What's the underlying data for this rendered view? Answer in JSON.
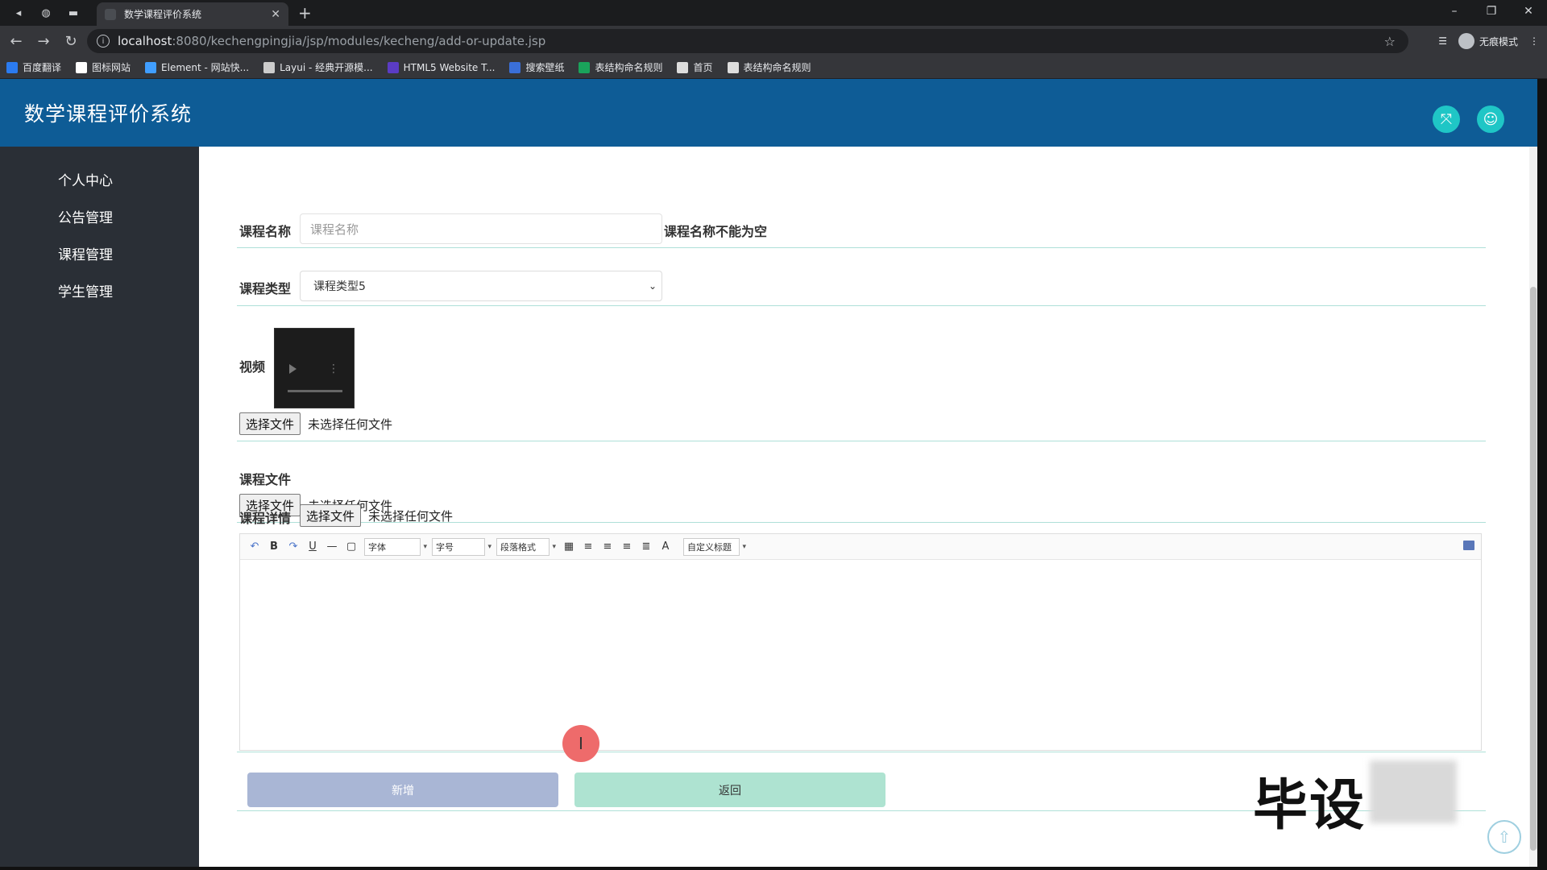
{
  "browser": {
    "tab_title": "数学课程评价系统",
    "tab_close": "✕",
    "new_tab": "+",
    "url_host": "localhost",
    "url_path": ":8080/kechengpingjia/jsp/modules/kecheng/add-or-update.jsp",
    "incognito_label": "无痕模式",
    "bookmarks": [
      {
        "label": "百度翻译",
        "color": "#2b7bf0"
      },
      {
        "label": "图标网站",
        "color": "#ffffff"
      },
      {
        "label": "Element - 网站快...",
        "color": "#409eff"
      },
      {
        "label": "Layui - 经典开源模...",
        "color": "#cccccc"
      },
      {
        "label": "HTML5 Website T...",
        "color": "#5b3cc4"
      },
      {
        "label": "搜索壁纸",
        "color": "#3a6fd8"
      },
      {
        "label": "表结构命名规则",
        "color": "#1aa35b"
      },
      {
        "label": "首页",
        "color": "#dddddd"
      },
      {
        "label": "表结构命名规则",
        "color": "#dddddd"
      }
    ]
  },
  "app": {
    "title": "数学课程评价系统",
    "colors": {
      "header": "#0e5c96",
      "sidebar": "#2a2f36",
      "accent": "#1fc6c6"
    }
  },
  "sidebar": {
    "items": [
      {
        "label": "个人中心"
      },
      {
        "label": "公告管理"
      },
      {
        "label": "课程管理"
      },
      {
        "label": "学生管理"
      }
    ]
  },
  "form": {
    "course_name": {
      "label": "课程名称",
      "placeholder": "课程名称",
      "value": "",
      "error": "课程名称不能为空"
    },
    "course_type": {
      "label": "课程类型",
      "selected": "课程类型5"
    },
    "video": {
      "label": "视频",
      "file_button": "选择文件",
      "file_status": "未选择任何文件"
    },
    "course_file": {
      "label": "课程文件",
      "file_button": "选择文件",
      "file_status": "未选择任何文件"
    },
    "course_detail": {
      "label": "课程详情",
      "file_button": "选择文件",
      "file_status": "未选择任何文件"
    }
  },
  "editor": {
    "font_family": "字体",
    "font_size": "字号",
    "paragraph": "段落格式",
    "custom_heading": "自定义标题",
    "bold": "B",
    "underline": "U",
    "font_color": "A"
  },
  "actions": {
    "add_label": "新增",
    "back_label": "返回"
  },
  "overlay": {
    "watermark_text": "毕设"
  }
}
